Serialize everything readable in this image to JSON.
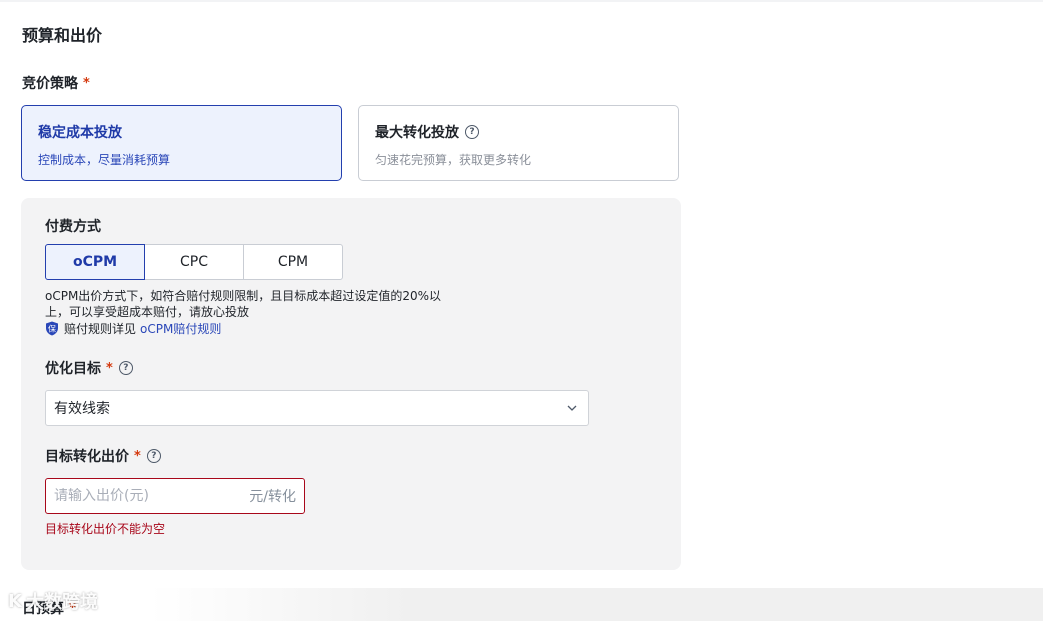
{
  "section": {
    "title": "预算和出价"
  },
  "bid_strategy": {
    "label": "竞价策略",
    "required_mark": "*",
    "options": [
      {
        "title": "稳定成本投放",
        "desc": "控制成本，尽量消耗预算",
        "selected": true
      },
      {
        "title": "最大转化投放",
        "desc": "匀速花完预算，获取更多转化",
        "selected": false,
        "help": "?"
      }
    ]
  },
  "payment": {
    "label": "付费方式",
    "options": [
      "oCPM",
      "CPC",
      "CPM"
    ],
    "selected": "oCPM",
    "notice": "oCPM出价方式下，如符合赔付规则限制，且目标成本超过设定值的20%以上，可以享受超成本赔付，请放心投放",
    "rule_prefix": "赔付规则详见",
    "rule_link": "oCPM赔付规则",
    "shield_char": "保"
  },
  "optimization_goal": {
    "label": "优化目标",
    "required_mark": "*",
    "help": "?",
    "value": "有效线索"
  },
  "target_bid": {
    "label": "目标转化出价",
    "required_mark": "*",
    "help": "?",
    "placeholder": "请输入出价(元)",
    "suffix": "元/转化",
    "error": "目标转化出价不能为空"
  },
  "daily_budget": {
    "label": "日预算",
    "required_mark": "*"
  },
  "watermark": {
    "text": "大数跨境",
    "logo": "K"
  },
  "colors": {
    "accent": "#233fae",
    "error": "#a8071a",
    "panel_bg": "#f3f3f4"
  }
}
